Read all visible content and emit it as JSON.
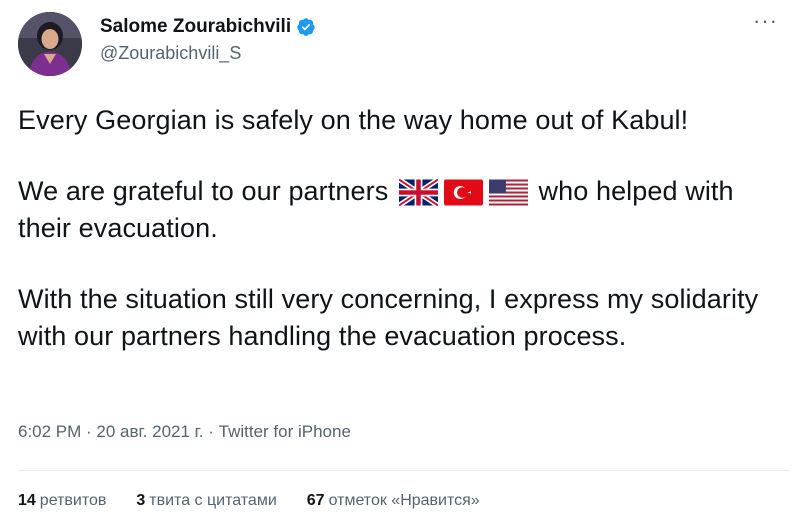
{
  "author": {
    "display_name": "Salome Zourabichvili",
    "handle": "@Zourabichvili_S",
    "verified": true
  },
  "more_menu": "···",
  "tweet": {
    "line1": "Every Georgian is safely on the way home out of Kabul!",
    "line2_before": "We are grateful to our partners",
    "line2_after": "who helped with their evacuation.",
    "flags": [
      "uk-flag-icon",
      "turkey-flag-icon",
      "us-flag-icon"
    ],
    "line3": "With the situation still very concerning, I express my solidarity with our partners handling the evacuation process."
  },
  "meta": {
    "time": "6:02 PM",
    "date": "20 авг. 2021 г.",
    "source": "Twitter for iPhone",
    "separator": " · "
  },
  "stats": {
    "retweets_count": "14",
    "retweets_label": "ретвитов",
    "quotes_count": "3",
    "quotes_label": "твита с цитатами",
    "likes_count": "67",
    "likes_label": "отметок «Нравится»"
  },
  "colors": {
    "text": "#0f1419",
    "secondary": "#536471",
    "verified": "#1d9bf0",
    "divider": "#e6ecf0"
  }
}
